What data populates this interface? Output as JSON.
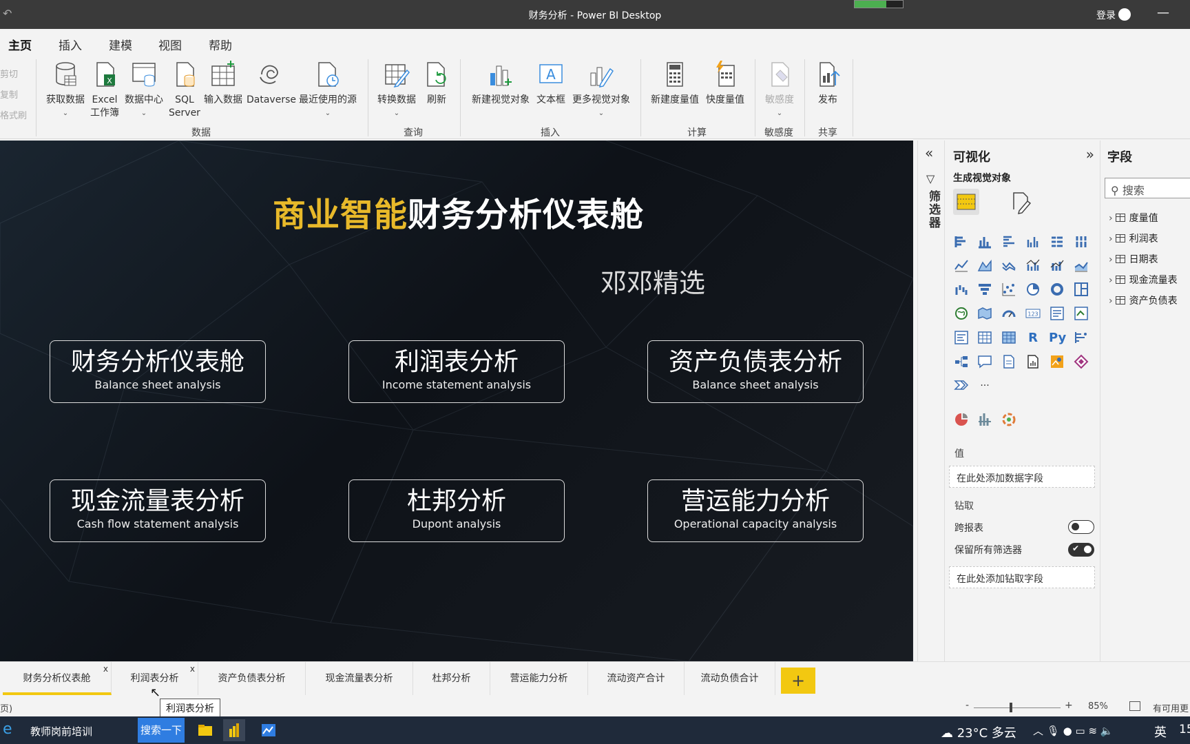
{
  "window": {
    "title": "财务分析 - Power BI Desktop",
    "signin": "登录"
  },
  "menu": [
    "主页",
    "插入",
    "建模",
    "视图",
    "帮助"
  ],
  "clipboard": [
    "剪切",
    "复制",
    "格式刷"
  ],
  "ribbon": {
    "get_data": "获取数据",
    "excel_1": "Excel",
    "excel_2": "工作簿",
    "datahub": "数据中心",
    "sql_1": "SQL",
    "sql_2": "Server",
    "enter_data": "输入数据",
    "dataverse": "Dataverse",
    "recent": "最近使用的源",
    "transform": "转换数据",
    "refresh": "刷新",
    "new_visual": "新建视觉对象",
    "textbox": "文本框",
    "more_visuals": "更多视觉对象",
    "new_measure": "新建度量值",
    "quick_measure": "快度量值",
    "sensitivity": "敏感度",
    "publish": "发布",
    "groups": {
      "data": "数据",
      "query": "查询",
      "insert": "插入",
      "calc": "计算",
      "sensitivity": "敏感度",
      "share": "共享"
    }
  },
  "canvas": {
    "headline_gold": "商业智能",
    "headline_white": "财务分析仪表舱",
    "subtitle": "邓邓精选",
    "cards": [
      {
        "cn": "财务分析仪表舱",
        "en": "Balance sheet analysis"
      },
      {
        "cn": "利润表分析",
        "en": "Income statement analysis"
      },
      {
        "cn": "资产负债表分析",
        "en": "Balance sheet analysis"
      },
      {
        "cn": "现金流量表分析",
        "en": "Cash flow statement analysis"
      },
      {
        "cn": "杜邦分析",
        "en": "Dupont analysis"
      },
      {
        "cn": "营运能力分析",
        "en": "Operational capacity analysis"
      }
    ]
  },
  "filters": {
    "label": "筛选器"
  },
  "viz": {
    "title": "可视化",
    "build": "生成视觉对象",
    "values_label": "值",
    "values_drop": "在此处添加数据字段",
    "drill_label": "钻取",
    "cross_report": "跨报表",
    "cross_report_on": false,
    "keep_filters": "保留所有筛选器",
    "keep_filters_on": true,
    "drill_drop": "在此处添加钻取字段",
    "more": "···",
    "r_visual": "R",
    "py_visual": "Py",
    "card_visual": "123"
  },
  "fields": {
    "title": "字段",
    "search_placeholder": "搜索",
    "tables": [
      "度量值",
      "利润表",
      "日期表",
      "现金流量表",
      "资产负债表"
    ]
  },
  "pages": [
    "财务分析仪表舱",
    "利润表分析",
    "资产负债表分析",
    "现金流量表分析",
    "杜邦分析",
    "营运能力分析",
    "流动资产合计",
    "流动负债合计"
  ],
  "active_page": 0,
  "tooltip": "利润表分析",
  "status": {
    "page": "页)",
    "zoom": "85%",
    "update": "有可用更",
    "zoom_minus": "-",
    "zoom_plus": "+"
  },
  "taskbar": {
    "ie_label": "教师岗前培训",
    "search_btn": "搜索一下",
    "weather": "23°C 多云",
    "ime": "英",
    "clock": "15"
  },
  "colors": {
    "accent": "#f2c811",
    "gold": "#e8b92a",
    "canvas_bg": "#0e1218",
    "taskbar": "#1f2a3a",
    "search_btn": "#2f7de1"
  }
}
